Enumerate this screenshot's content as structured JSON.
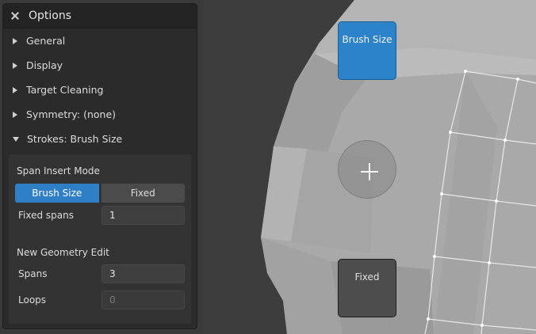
{
  "panel": {
    "title": "Options",
    "sections": [
      {
        "label": "General",
        "expanded": false
      },
      {
        "label": "Display",
        "expanded": false
      },
      {
        "label": "Target Cleaning",
        "expanded": false
      },
      {
        "label": "Symmetry: (none)",
        "expanded": false
      },
      {
        "label": "Strokes: Brush Size",
        "expanded": true
      }
    ],
    "strokes": {
      "span_insert_mode_label": "Span Insert Mode",
      "mode_options": [
        "Brush Size",
        "Fixed"
      ],
      "selected_mode": "Brush Size",
      "fixed_spans_label": "Fixed spans",
      "fixed_spans_value": "1",
      "new_geometry_label": "New Geometry Edit",
      "spans_label": "Spans",
      "spans_value": "3",
      "loops_label": "Loops",
      "loops_value": "0"
    }
  },
  "viewport": {
    "pie_menu": {
      "top_label": "Brush Size",
      "bottom_label": "Fixed"
    }
  },
  "colors": {
    "accent": "#2d83c9",
    "panel_bg": "#2b2b2b",
    "viewport_bg": "#3d3d3d"
  }
}
